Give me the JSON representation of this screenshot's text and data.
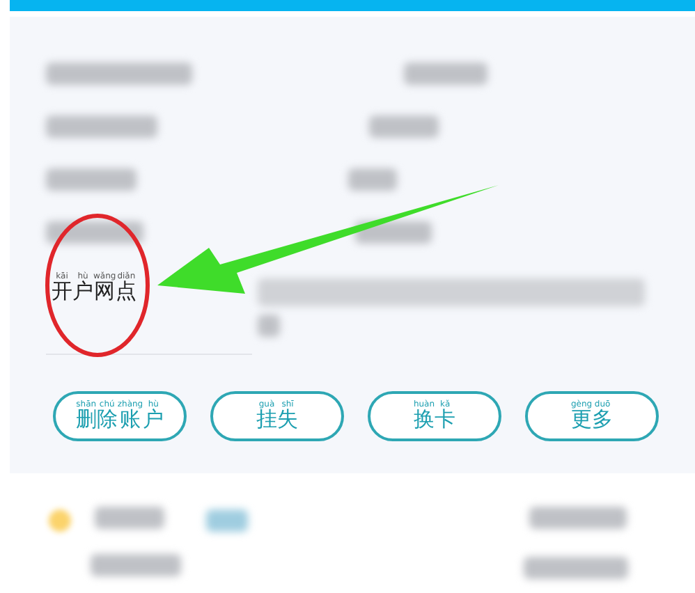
{
  "detail_card": {
    "rows": [
      {
        "kind": "blurred"
      },
      {
        "kind": "blurred"
      },
      {
        "kind": "blurred"
      },
      {
        "kind": "blurred"
      }
    ],
    "branch": {
      "label": [
        {
          "char": "开",
          "pinyin": "kāi"
        },
        {
          "char": "户",
          "pinyin": "hù"
        },
        {
          "char": "网",
          "pinyin": "wǎng"
        },
        {
          "char": "点",
          "pinyin": "diǎn"
        }
      ]
    },
    "buttons": [
      {
        "label": [
          {
            "char": "删",
            "pinyin": "shān"
          },
          {
            "char": "除",
            "pinyin": "chú"
          },
          {
            "char": "账",
            "pinyin": "zhàng"
          },
          {
            "char": "户",
            "pinyin": "hù"
          }
        ]
      },
      {
        "label": [
          {
            "char": "挂",
            "pinyin": "guà"
          },
          {
            "char": "失",
            "pinyin": "shī"
          }
        ]
      },
      {
        "label": [
          {
            "char": "换",
            "pinyin": "huàn"
          },
          {
            "char": "卡",
            "pinyin": "kǎ"
          }
        ]
      },
      {
        "label": [
          {
            "char": "更",
            "pinyin": "gèng"
          },
          {
            "char": "多",
            "pinyin": "duō"
          }
        ]
      }
    ]
  }
}
